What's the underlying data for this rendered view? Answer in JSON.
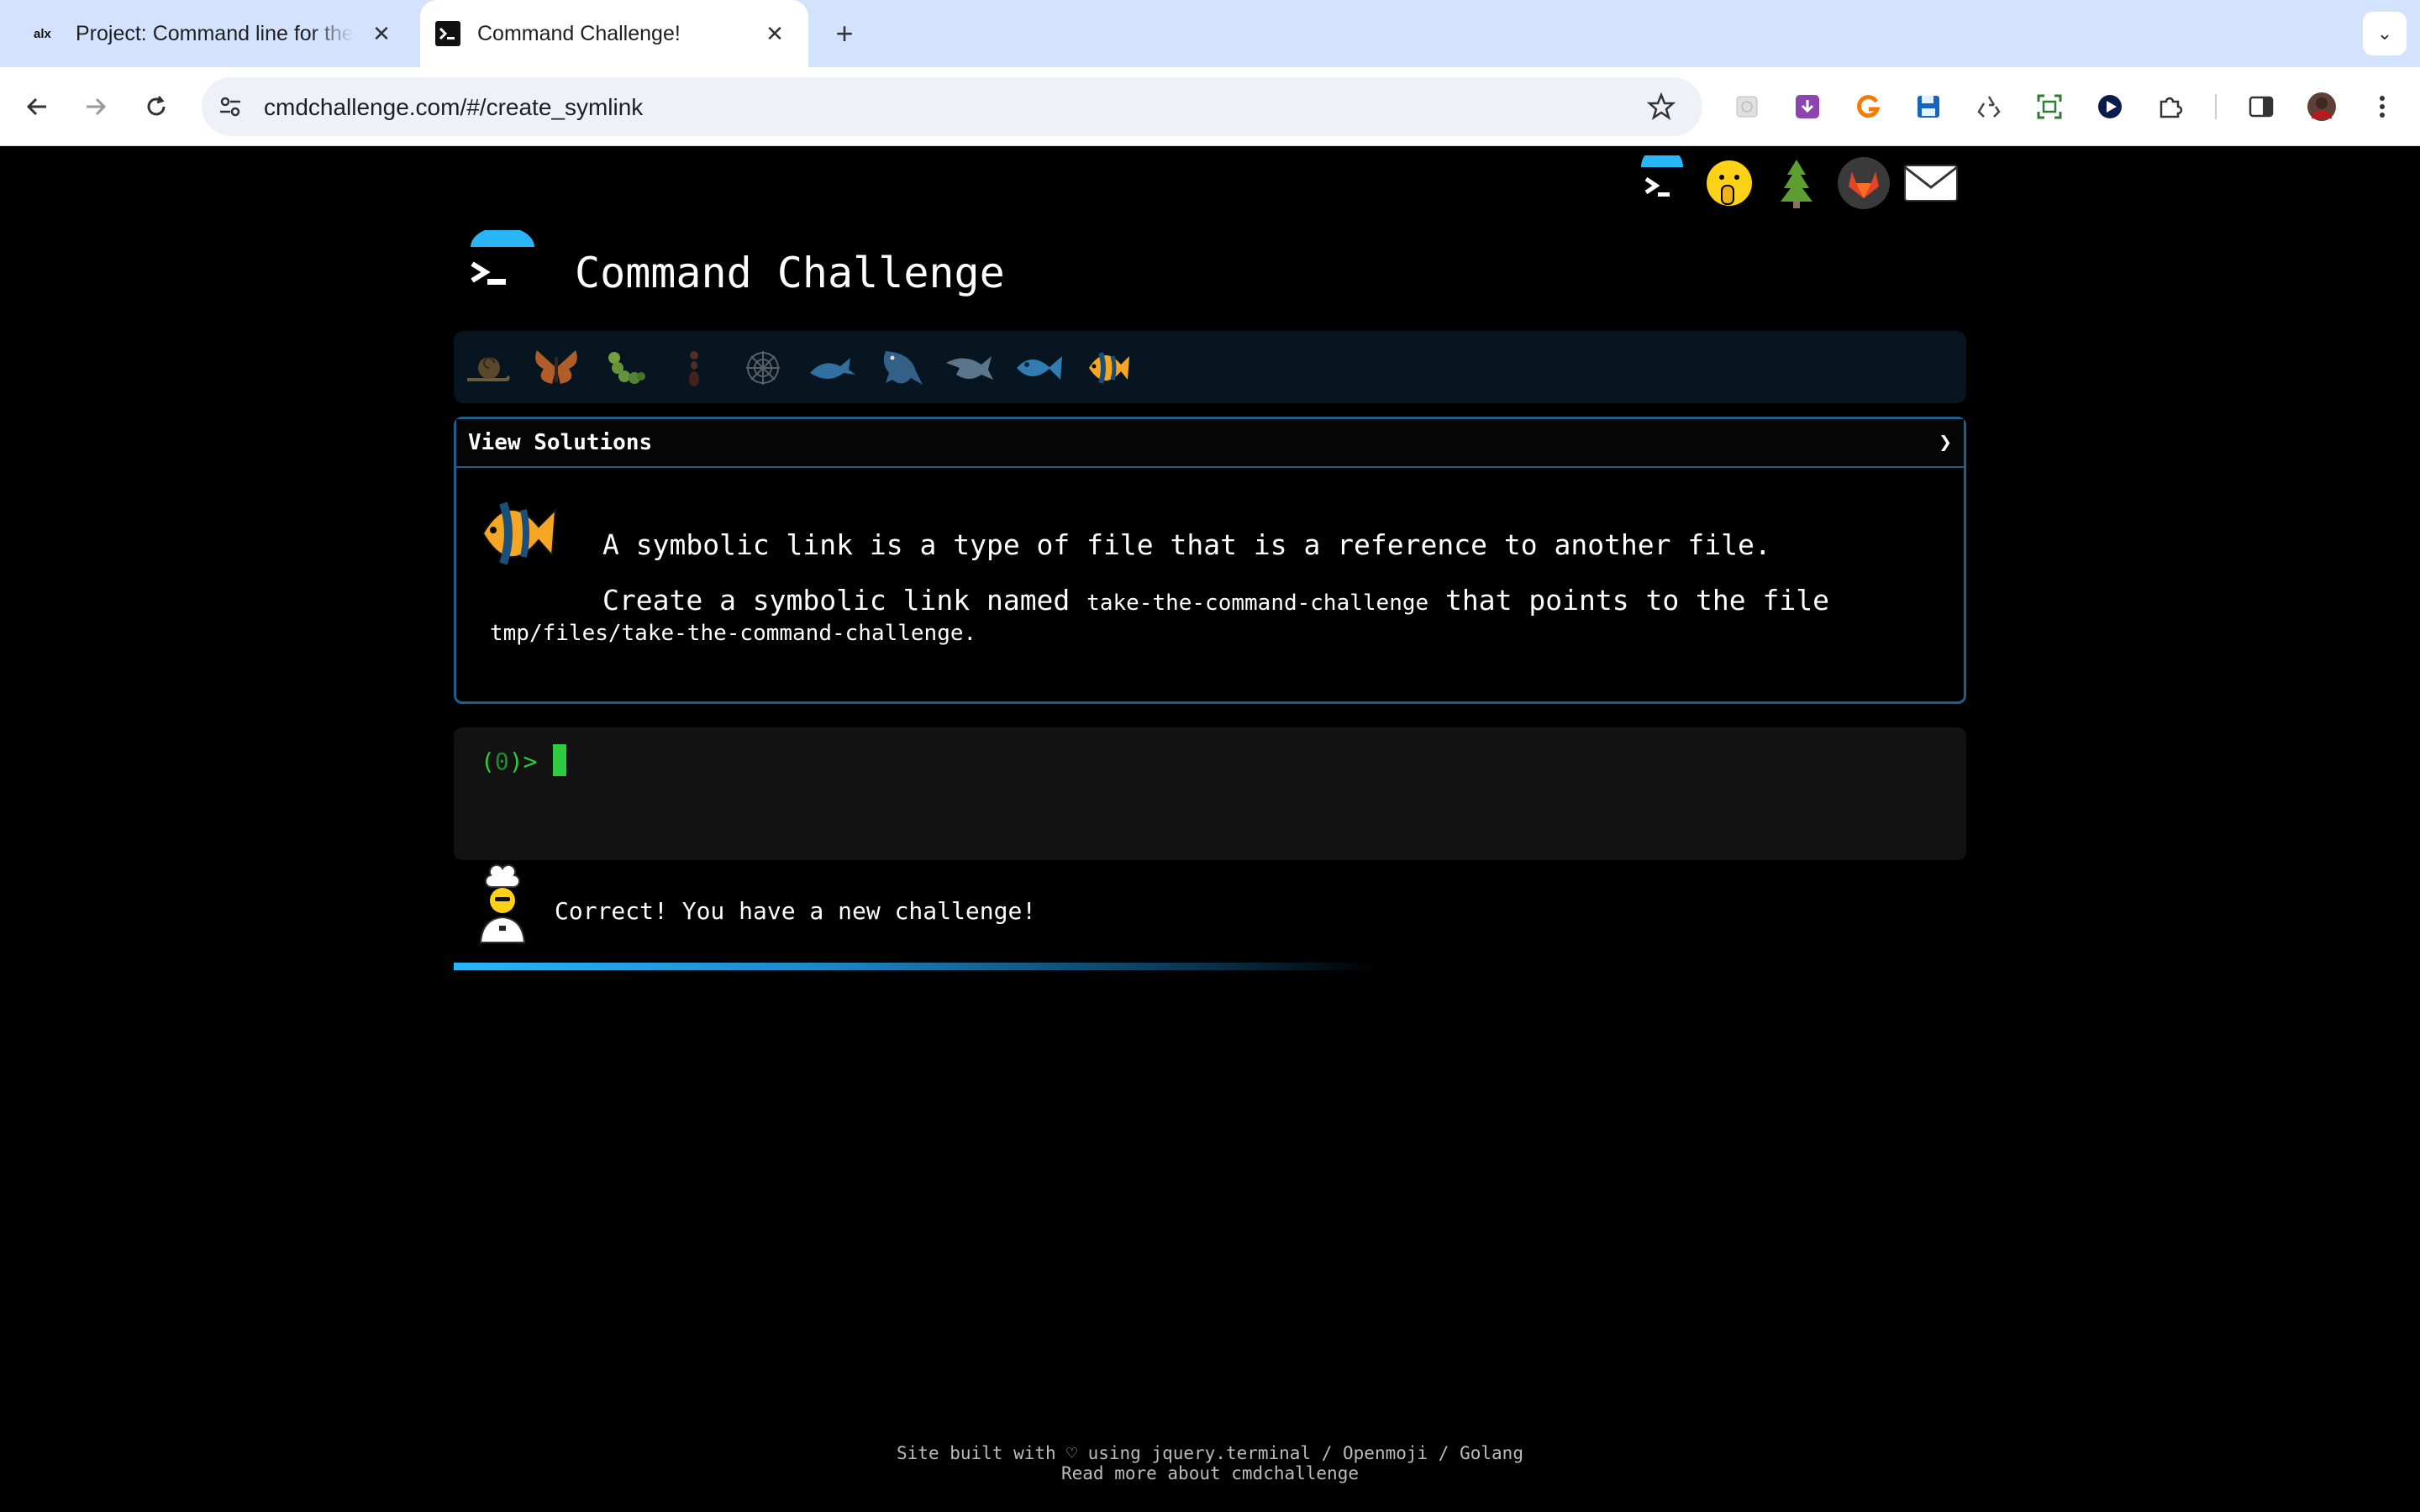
{
  "browser": {
    "tabs": [
      {
        "title": "Project: Command line for the",
        "favicon": "alx-logo",
        "active": false
      },
      {
        "title": "Command Challenge!",
        "favicon": "terminal-icon",
        "active": true
      }
    ],
    "url": "cmdchallenge.com/#/create_symlink",
    "extensions": [
      "grid-extension-icon",
      "download-extension-icon",
      "grammarly-icon",
      "save-icon",
      "recycle-icon",
      "screenshot-icon",
      "play-icon",
      "puzzle-icon",
      "side-panel-icon",
      "profile-avatar"
    ]
  },
  "header": {
    "title": "Command Challenge"
  },
  "top_icons": [
    "terminal-logo-icon",
    "shushing-face-icon",
    "tree-icon",
    "gitlab-icon",
    "mail-icon"
  ],
  "badges": [
    "snail-icon",
    "butterfly-icon",
    "caterpillar-icon",
    "ant-icon",
    "spider-web-icon",
    "whale-icon",
    "shark-icon",
    "dolphin-icon",
    "fish-icon",
    "tropical-fish-icon"
  ],
  "solutions": {
    "label": "View Solutions",
    "chevron": "❯"
  },
  "challenge": {
    "line1": "A symbolic link is a type of file that is a reference to another file.",
    "line2_prefix": "Create a symbolic link named ",
    "link_name": "take-the-command-challenge",
    "line2_suffix": " that points to the file",
    "target_path": "tmp/files/take-the-command-challenge",
    "period": "."
  },
  "terminal": {
    "prompt_open": "(",
    "prompt_num": "0",
    "prompt_close": ")> "
  },
  "status": {
    "message": "Correct! You have a new challenge!",
    "progress": 0.6
  },
  "footer": {
    "line1": "Site built with ♡ using jquery.terminal / Openmoji / Golang",
    "line2": "Read more about cmdchallenge"
  }
}
